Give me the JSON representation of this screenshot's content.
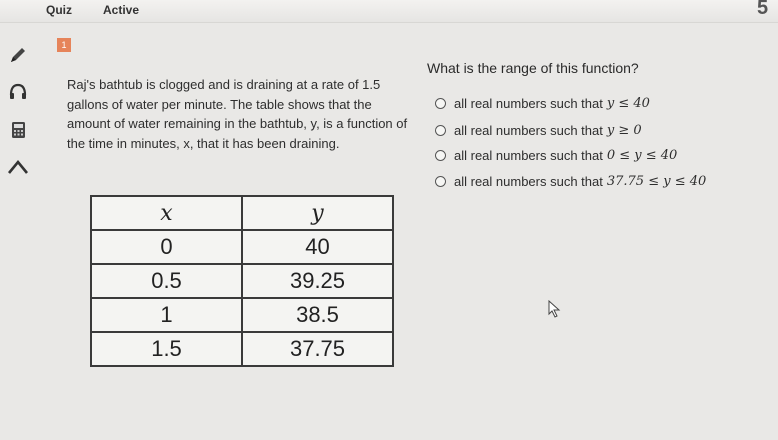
{
  "header": {
    "app_title": "Quiz",
    "status": "Active",
    "timer_peek": "5"
  },
  "sidebar": {
    "tools": [
      {
        "name": "pencil-icon"
      },
      {
        "name": "headphones-icon"
      },
      {
        "name": "calculator-icon"
      },
      {
        "name": "arrow-up-icon"
      }
    ]
  },
  "question": {
    "number": "1",
    "passage": "Raj's bathtub is clogged and is draining at a rate of 1.5 gallons of water per minute. The table shows that the amount of water remaining in the bathtub, y, is a function of the time in minutes, x, that it has been draining.",
    "prompt": "What is the range of this function?",
    "table": {
      "headers": [
        "x",
        "y"
      ],
      "rows": [
        [
          "0",
          "40"
        ],
        [
          "0.5",
          "39.25"
        ],
        [
          "1",
          "38.5"
        ],
        [
          "1.5",
          "37.75"
        ]
      ]
    },
    "options": [
      {
        "text": "all real numbers such that",
        "math": "y ≤ 40"
      },
      {
        "text": "all real numbers such that",
        "math": "y ≥ 0"
      },
      {
        "text": "all real numbers such that",
        "math": "0 ≤ y ≤ 40"
      },
      {
        "text": "all real numbers such that",
        "math": "37.75 ≤ y ≤ 40"
      }
    ]
  }
}
